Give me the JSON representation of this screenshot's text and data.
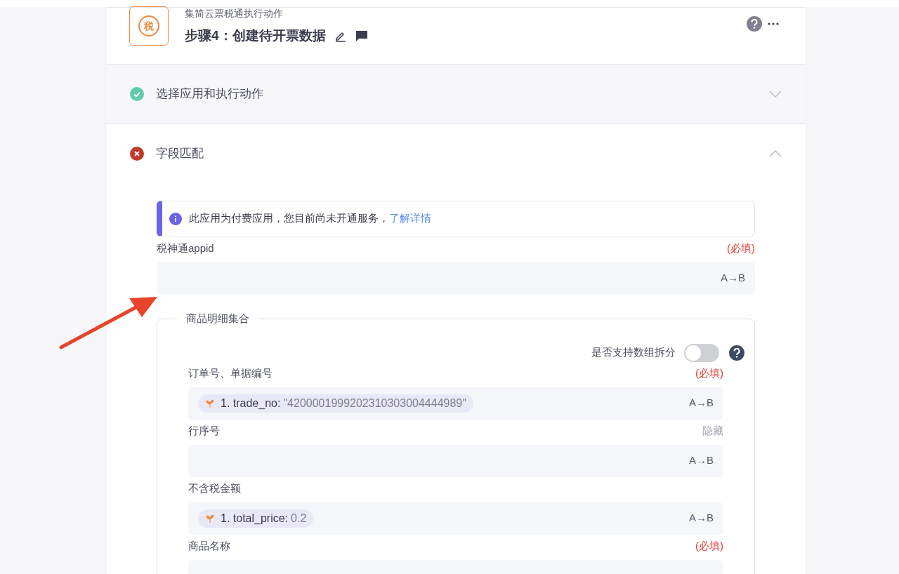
{
  "header": {
    "logo_text": "税",
    "app_action": "集简云票税通执行动作",
    "step_title": "步骤4：创建待开票数据"
  },
  "sections": [
    {
      "title": "选择应用和执行动作",
      "kind": "success",
      "expanded": false
    },
    {
      "title": "字段匹配",
      "kind": "error",
      "expanded": true
    }
  ],
  "notice": {
    "text": "此应用为付费应用，您目前尚未开通服务，",
    "link": "了解详情"
  },
  "fields": [
    {
      "label": "税神通appid",
      "tag": "(必填)",
      "kind": "required",
      "mapper": "A→B"
    }
  ],
  "group": {
    "legend": "商品明细集合",
    "toggle": {
      "label": "是否支持数组拆分",
      "on": false
    },
    "fields": [
      {
        "label": "订单号、单据编号",
        "tag": "(必填)",
        "kind": "required",
        "token": {
          "key": "1. trade_no:",
          "value": "\"4200001999202310303004444989\""
        },
        "mapper": "A→B"
      },
      {
        "label": "行序号",
        "tag": "隐藏",
        "kind": "hidden",
        "mapper": "A→B"
      },
      {
        "label": "不含税金额",
        "token": {
          "key": "1. total_price:",
          "value": "0.2"
        },
        "mapper": "A→B"
      },
      {
        "label": "商品名称",
        "tag": "(必填)",
        "kind": "required"
      }
    ]
  }
}
